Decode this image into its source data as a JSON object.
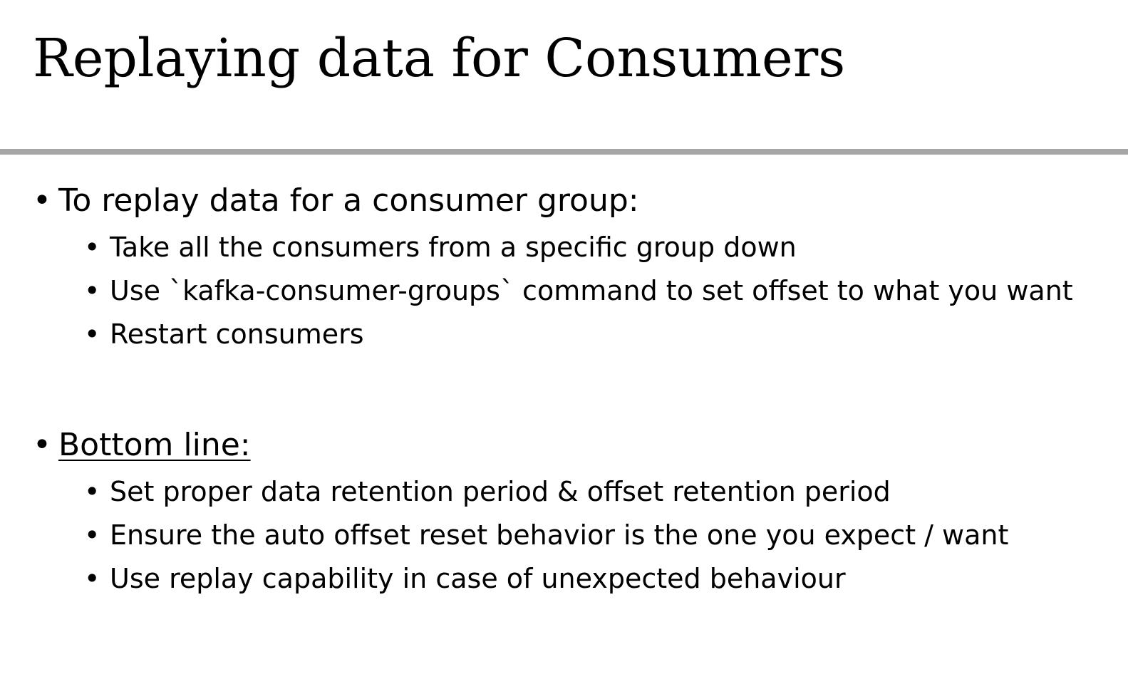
{
  "slide": {
    "title": "Replaying data for Consumers",
    "rule_color": "#a6a6a6",
    "sections": [
      {
        "heading": "To replay data for a consumer group:",
        "items": [
          "Take all the consumers from a specific group down",
          "Use `kafka-consumer-groups` command to set offset to what you want",
          "Restart consumers"
        ]
      },
      {
        "heading": "Bottom line:",
        "items": [
          "Set proper data retention period & offset retention period",
          "Ensure the auto offset reset behavior is the one you expect / want",
          "Use replay capability in case of unexpected behaviour"
        ]
      }
    ]
  }
}
